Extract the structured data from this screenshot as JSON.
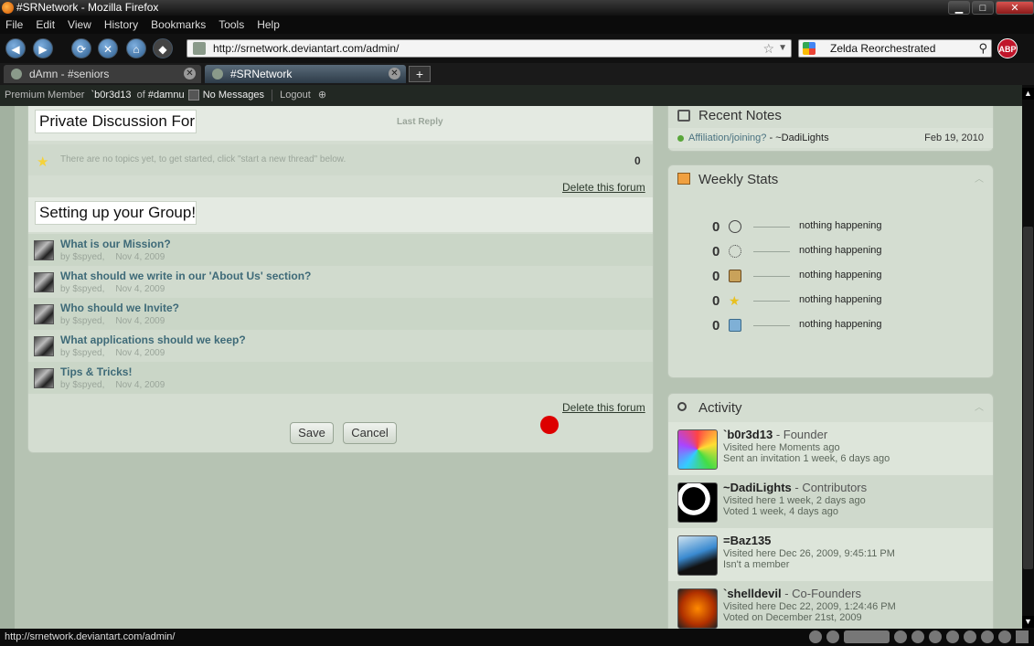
{
  "window": {
    "title": "#SRNetwork - Mozilla Firefox"
  },
  "menu": [
    "File",
    "Edit",
    "View",
    "History",
    "Bookmarks",
    "Tools",
    "Help"
  ],
  "nav": {
    "url": "http://srnetwork.deviantart.com/admin/",
    "search_value": "Zelda Reorchestrated",
    "abp_label": "ABP"
  },
  "tabs": [
    {
      "label": "dAmn - #seniors"
    },
    {
      "label": "#SRNetwork"
    }
  ],
  "tab_new_label": "+",
  "dabar": {
    "membership": "Premium Member",
    "username": "`b0r3d13",
    "of_label": "of",
    "group": "#damnu",
    "messages": "No Messages",
    "logout": "Logout"
  },
  "forum1": {
    "title": "Private Discussion Foru",
    "last_reply_label": "Last Reply",
    "empty_message": "There are no topics yet, to get started, click \"start a new thread\" below.",
    "count": "0",
    "delete_label": "Delete this forum"
  },
  "forum2": {
    "title": "Setting up your Group!",
    "threads": [
      {
        "title": "What is our Mission?",
        "by": "by $spyed,",
        "date": "Nov 4, 2009"
      },
      {
        "title": "What should we write in our 'About Us' section?",
        "by": "by $spyed,",
        "date": "Nov 4, 2009"
      },
      {
        "title": "Who should we Invite?",
        "by": "by $spyed,",
        "date": "Nov 4, 2009"
      },
      {
        "title": "What applications should we keep?",
        "by": "by $spyed,",
        "date": "Nov 4, 2009"
      },
      {
        "title": "Tips & Tricks!",
        "by": "by $spyed,",
        "date": "Nov 4, 2009"
      }
    ],
    "delete_label": "Delete this forum"
  },
  "buttons": {
    "save": "Save",
    "cancel": "Cancel"
  },
  "recent_notes": {
    "title": "Recent Notes",
    "items": [
      {
        "subject": "Affiliation/joining?",
        "sep": " - ",
        "from": "~DadiLights",
        "date": "Feb 19, 2010"
      }
    ]
  },
  "weekly_stats": {
    "title": "Weekly Stats",
    "rows": [
      {
        "value": "0",
        "icon": "deviation-icon",
        "color": "#dfe6dc",
        "text": "nothing happening"
      },
      {
        "value": "0",
        "icon": "members-icon",
        "color": "#dfe6dc",
        "text": "nothing happening"
      },
      {
        "value": "0",
        "icon": "badge-icon",
        "color": "#c9a25a",
        "text": "nothing happening"
      },
      {
        "value": "0",
        "icon": "star-icon",
        "color": "#f5d23a",
        "text": "nothing happening"
      },
      {
        "value": "0",
        "icon": "journal-icon",
        "color": "#7fb0d6",
        "text": "nothing happening"
      }
    ]
  },
  "activity": {
    "title": "Activity",
    "members": [
      {
        "name": "`b0r3d13",
        "role": " - Founder",
        "line1": "Visited here Moments ago",
        "line2": "Sent an invitation 1 week, 6 days ago"
      },
      {
        "name": "~DadiLights",
        "role": " - Contributors",
        "line1": "Visited here 1 week, 2 days ago",
        "line2": "Voted 1 week, 4 days ago"
      },
      {
        "name": "=Baz135",
        "role": "",
        "line1": "Visited here Dec 26, 2009, 9:45:11 PM",
        "line2": "Isn't a member"
      },
      {
        "name": "`shelldevil",
        "role": " - Co-Founders",
        "line1": "Visited here Dec 22, 2009, 1:24:46 PM",
        "line2": "Voted on December 21st, 2009"
      }
    ]
  },
  "status": {
    "text": "http://srnetwork.deviantart.com/admin/"
  },
  "colors": {
    "accent_link": "#3e6a78",
    "page_bg": "#b6c3b3",
    "panel_bg": "#d4ddd1",
    "dot_red": "#dd0000"
  }
}
